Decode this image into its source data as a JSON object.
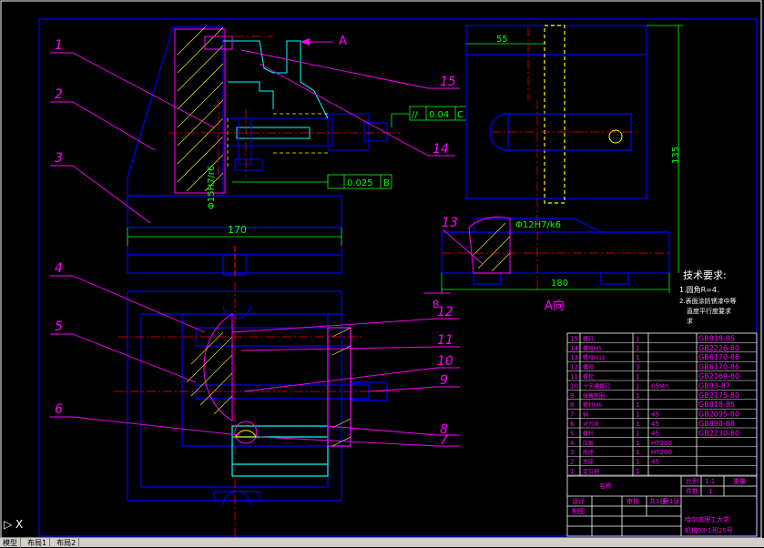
{
  "balloons": [
    "1",
    "2",
    "3",
    "4",
    "5",
    "6",
    "7",
    "8",
    "9",
    "10",
    "11",
    "12",
    "13",
    "14",
    "15"
  ],
  "view_label_top": "A",
  "view_label_side": "A向",
  "section_mark": "B",
  "dims": {
    "width_170": "170",
    "width_180": "180",
    "height_135": "135",
    "offset_55": "55",
    "fit_left": "Φ15H7/r6",
    "fit_right": "Φ12H7/k6"
  },
  "tolerance_frames": {
    "parallel": [
      "//",
      "0.04",
      "C"
    ],
    "flat": [
      "",
      "0.025",
      "B"
    ]
  },
  "tech_req": {
    "title": "技术要求:",
    "line1": "1.圆角R=4.",
    "line2": "2.表面涂防锈漆中等",
    "line3": "直度平行度要求",
    "line4": "求"
  },
  "bom": [
    {
      "no": "15",
      "name": "螺钉",
      "qty": "1",
      "mat": "",
      "std": "GB818-85"
    },
    {
      "no": "14",
      "name": "螺母M5",
      "qty": "1",
      "mat": "",
      "std": "GB2226-80"
    },
    {
      "no": "13",
      "name": "螺母M12",
      "qty": "1",
      "mat": "",
      "std": "GB6170-86"
    },
    {
      "no": "12",
      "name": "螺母",
      "qty": "3",
      "mat": "",
      "std": "GB6170-86"
    },
    {
      "no": "11",
      "name": "螺栓",
      "qty": "1",
      "mat": "",
      "std": "GB2169-80"
    },
    {
      "no": "10",
      "name": "十字槽螺钉",
      "qty": "1",
      "mat": "65Mn",
      "std": "GB93-87"
    },
    {
      "no": "9",
      "name": "弹簧垫圈",
      "qty": "1",
      "mat": "",
      "std": "GB2175-80"
    },
    {
      "no": "8",
      "name": "螺钉M6",
      "qty": "1",
      "mat": "",
      "std": "GB818-85"
    },
    {
      "no": "7",
      "name": "销",
      "qty": "1",
      "mat": "45",
      "std": "GB2095-80"
    },
    {
      "no": "6",
      "name": "对刀块",
      "qty": "1",
      "mat": "45",
      "std": "GB898-88"
    },
    {
      "no": "5",
      "name": "螺杆",
      "qty": "1",
      "mat": "45",
      "std": "GB2230-80"
    },
    {
      "no": "4",
      "name": "压板",
      "qty": "1",
      "mat": "HT200",
      "std": ""
    },
    {
      "no": "3",
      "name": "底座",
      "qty": "1",
      "mat": "HT200",
      "std": ""
    },
    {
      "no": "2",
      "name": "支座",
      "qty": "1",
      "mat": "45",
      "std": ""
    },
    {
      "no": "1",
      "name": "定位销",
      "qty": "1",
      "mat": "",
      "std": ""
    }
  ],
  "bom_header": [
    "序号",
    "名称",
    "数量",
    "材料",
    "备注"
  ],
  "title_block": {
    "ratio_label": "比例",
    "ratio": "1:1",
    "count_label": "件数",
    "count": "1",
    "weight_label": "重量",
    "sheet_label": "共1张",
    "page_label": "第1张",
    "design": "设计",
    "draw": "制图",
    "check": "审核",
    "school": "哈尔滨理工大学",
    "class": "机械03-1班25号"
  },
  "tabs": [
    "模型",
    "布局1",
    "布局2"
  ],
  "ucs_icon": "X",
  "colors": {
    "background": "#000000",
    "outline": "#0000ff",
    "leaders": "#ff00ff",
    "centerline": "#ff0000",
    "text": "#ffff00",
    "dim": "#00ff00",
    "hidden": "#ffff00",
    "table_text": "#ff00ff",
    "cyan": "#00ffff"
  }
}
